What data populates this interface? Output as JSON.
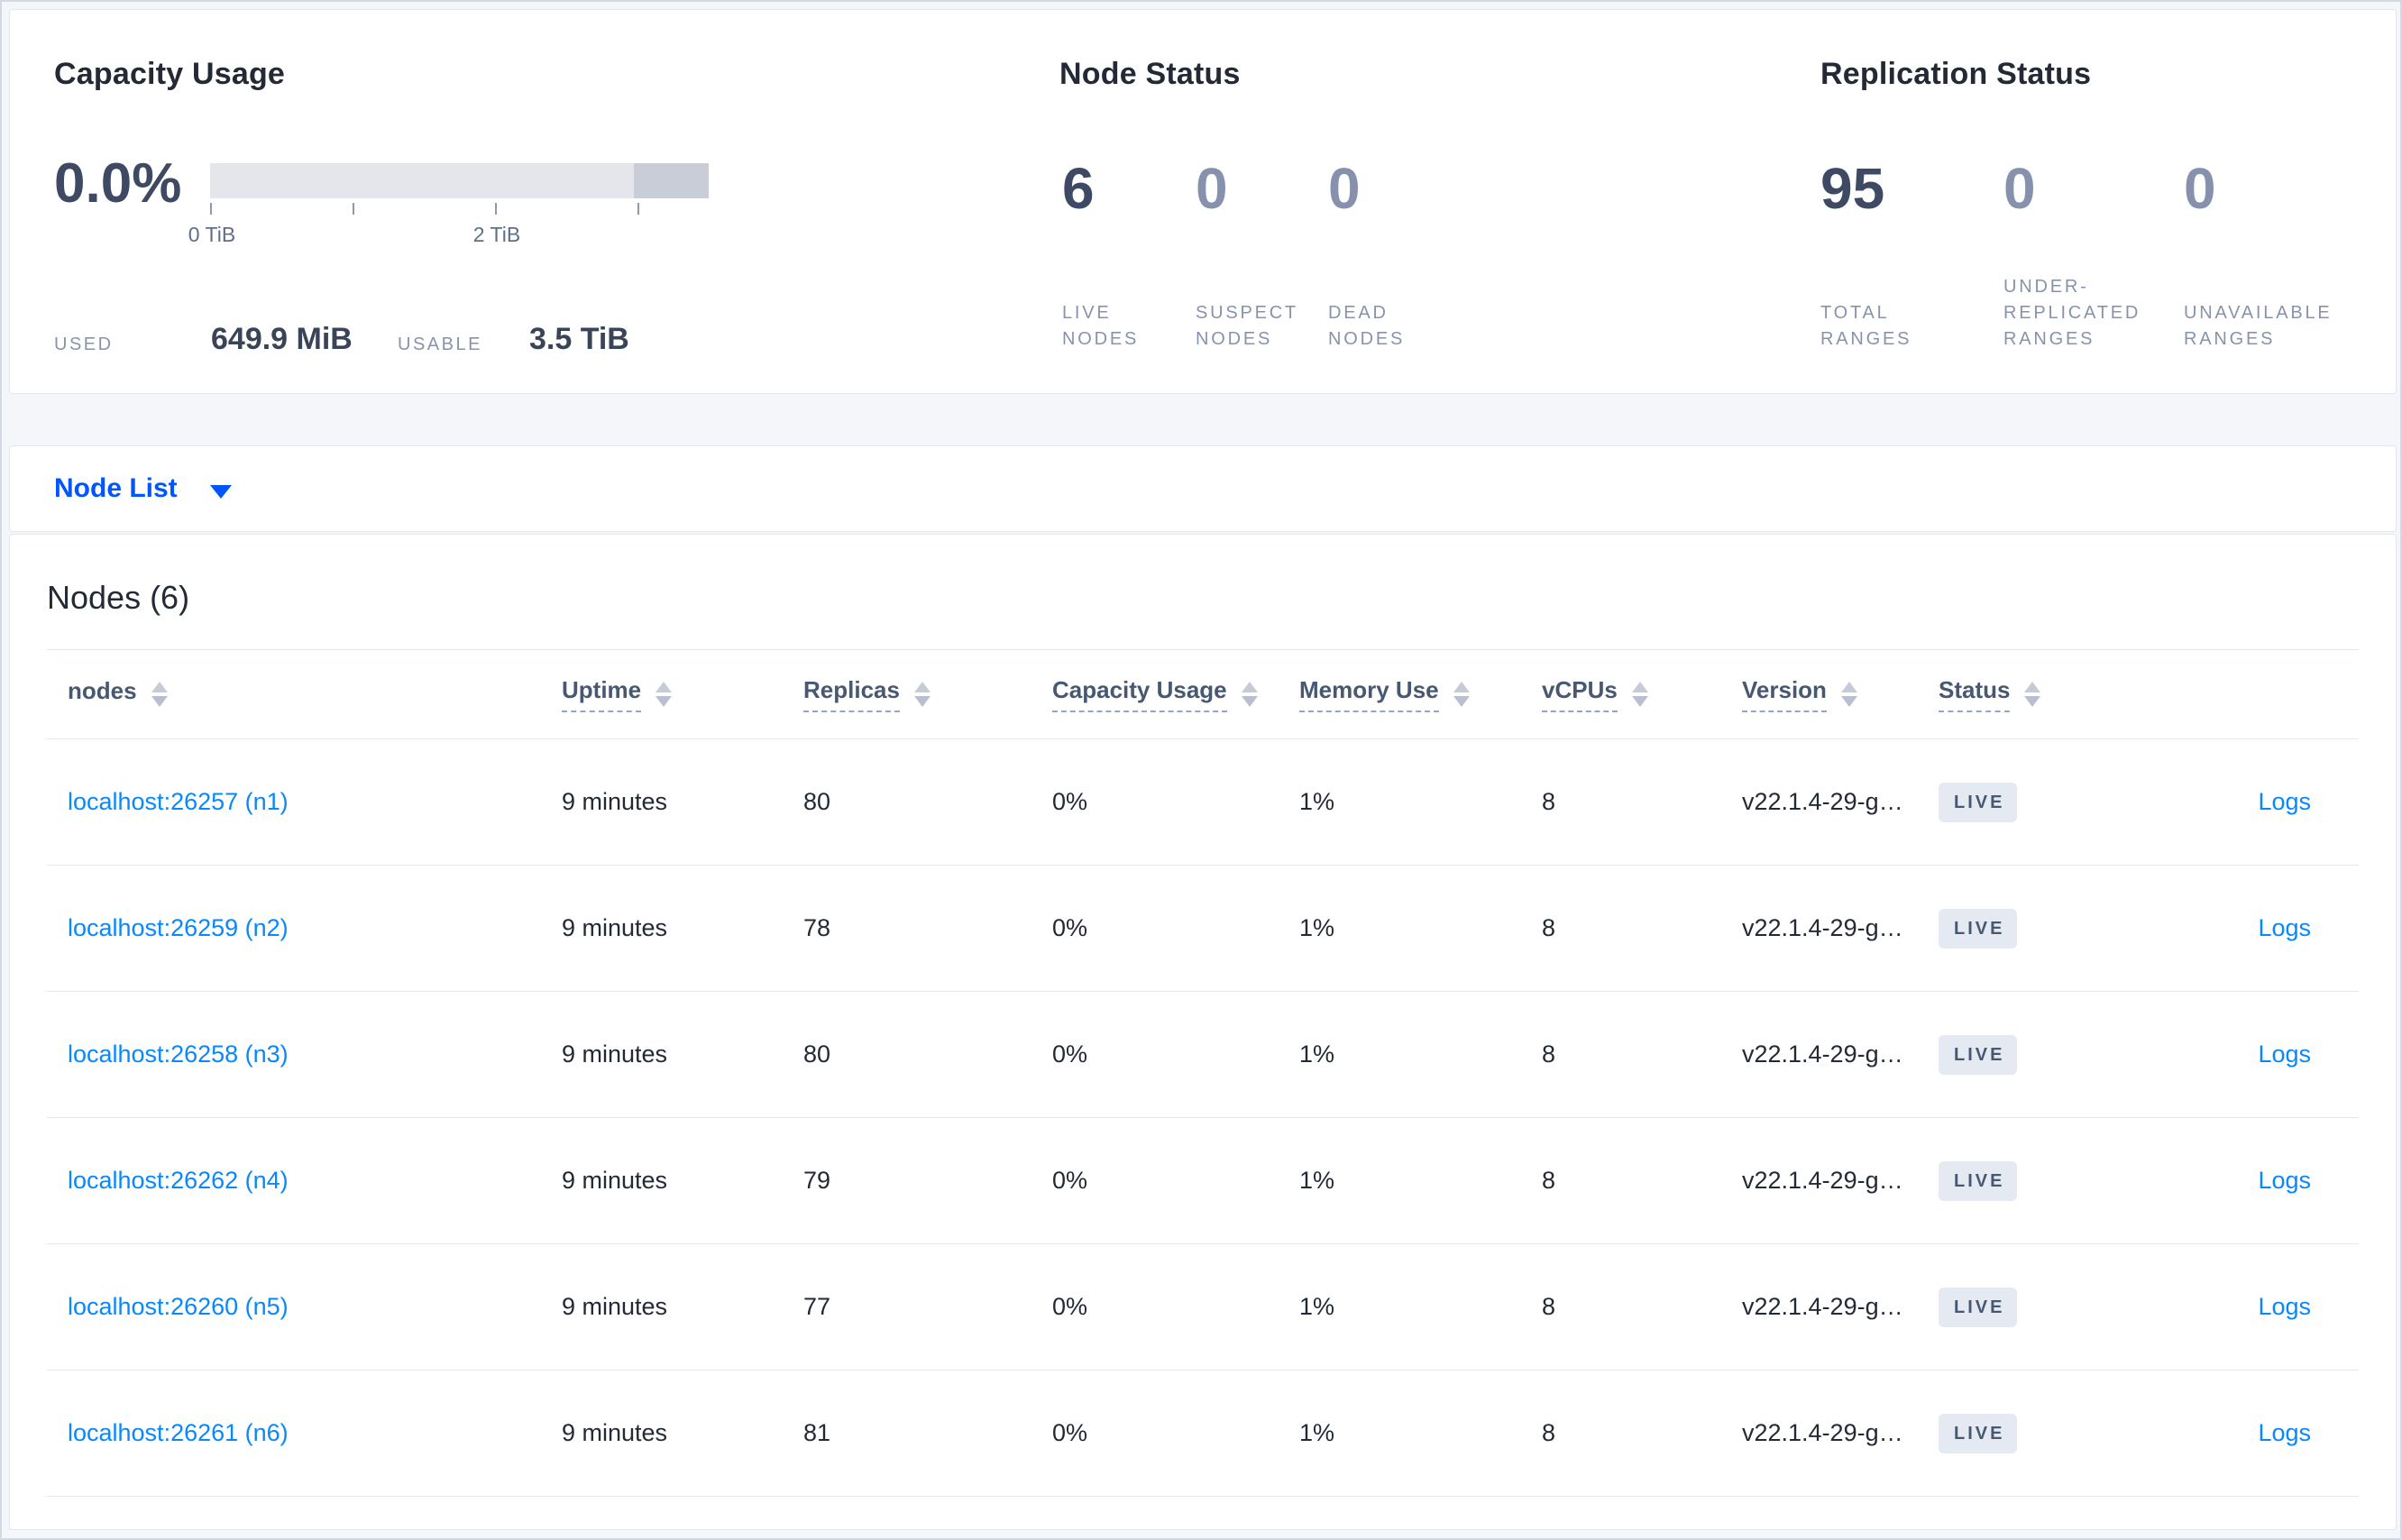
{
  "summary": {
    "capacity": {
      "title": "Capacity Usage",
      "percent_used": "0.0%",
      "tick_labels": [
        "0 TiB",
        "2 TiB"
      ],
      "used": {
        "label": "USED",
        "value": "649.9 MiB"
      },
      "usable": {
        "label": "USABLE",
        "value": "3.5 TiB"
      },
      "bar_colors": {
        "track": "#e4e6ec",
        "segment": "#c9cdd8"
      }
    },
    "node_status": {
      "title": "Node Status",
      "stats": [
        {
          "value": "6",
          "label": "LIVE NODES"
        },
        {
          "value": "0",
          "label": "SUSPECT NODES"
        },
        {
          "value": "0",
          "label": "DEAD NODES"
        }
      ]
    },
    "replication": {
      "title": "Replication Status",
      "stats": [
        {
          "value": "95",
          "label": "TOTAL RANGES"
        },
        {
          "value": "0",
          "label": "UNDER-REPLICATED RANGES"
        },
        {
          "value": "0",
          "label": "UNAVAILABLE RANGES"
        }
      ]
    }
  },
  "view_selector": {
    "label": "Node List"
  },
  "nodes_panel": {
    "title": "Nodes (6)",
    "columns": [
      {
        "label": "nodes"
      },
      {
        "label": "Uptime"
      },
      {
        "label": "Replicas"
      },
      {
        "label": "Capacity Usage"
      },
      {
        "label": "Memory Use"
      },
      {
        "label": "vCPUs"
      },
      {
        "label": "Version"
      },
      {
        "label": "Status"
      }
    ],
    "rows": [
      {
        "address": "localhost:26257 (n1)",
        "uptime": "9 minutes",
        "replicas": "80",
        "capacity_usage": "0%",
        "memory_use": "1%",
        "vcpus": "8",
        "version": "v22.1.4-29-g…",
        "status": "LIVE",
        "logs_label": "Logs"
      },
      {
        "address": "localhost:26259 (n2)",
        "uptime": "9 minutes",
        "replicas": "78",
        "capacity_usage": "0%",
        "memory_use": "1%",
        "vcpus": "8",
        "version": "v22.1.4-29-g…",
        "status": "LIVE",
        "logs_label": "Logs"
      },
      {
        "address": "localhost:26258 (n3)",
        "uptime": "9 minutes",
        "replicas": "80",
        "capacity_usage": "0%",
        "memory_use": "1%",
        "vcpus": "8",
        "version": "v22.1.4-29-g…",
        "status": "LIVE",
        "logs_label": "Logs"
      },
      {
        "address": "localhost:26262 (n4)",
        "uptime": "9 minutes",
        "replicas": "79",
        "capacity_usage": "0%",
        "memory_use": "1%",
        "vcpus": "8",
        "version": "v22.1.4-29-g…",
        "status": "LIVE",
        "logs_label": "Logs"
      },
      {
        "address": "localhost:26260 (n5)",
        "uptime": "9 minutes",
        "replicas": "77",
        "capacity_usage": "0%",
        "memory_use": "1%",
        "vcpus": "8",
        "version": "v22.1.4-29-g…",
        "status": "LIVE",
        "logs_label": "Logs"
      },
      {
        "address": "localhost:26261 (n6)",
        "uptime": "9 minutes",
        "replicas": "81",
        "capacity_usage": "0%",
        "memory_use": "1%",
        "vcpus": "8",
        "version": "v22.1.4-29-g…",
        "status": "LIVE",
        "logs_label": "Logs"
      }
    ]
  },
  "colors": {
    "page_background": "#f4f6f9",
    "card_background": "#ffffff",
    "card_border": "#e2e6ed",
    "primary_blue": "#0055ff",
    "link_blue": "#0788ff",
    "number_dark": "#3e4a63",
    "number_light": "#8691ae",
    "muted_label": "#8893ab",
    "table_header": "#475872",
    "badge_background": "#e4e9f2"
  }
}
